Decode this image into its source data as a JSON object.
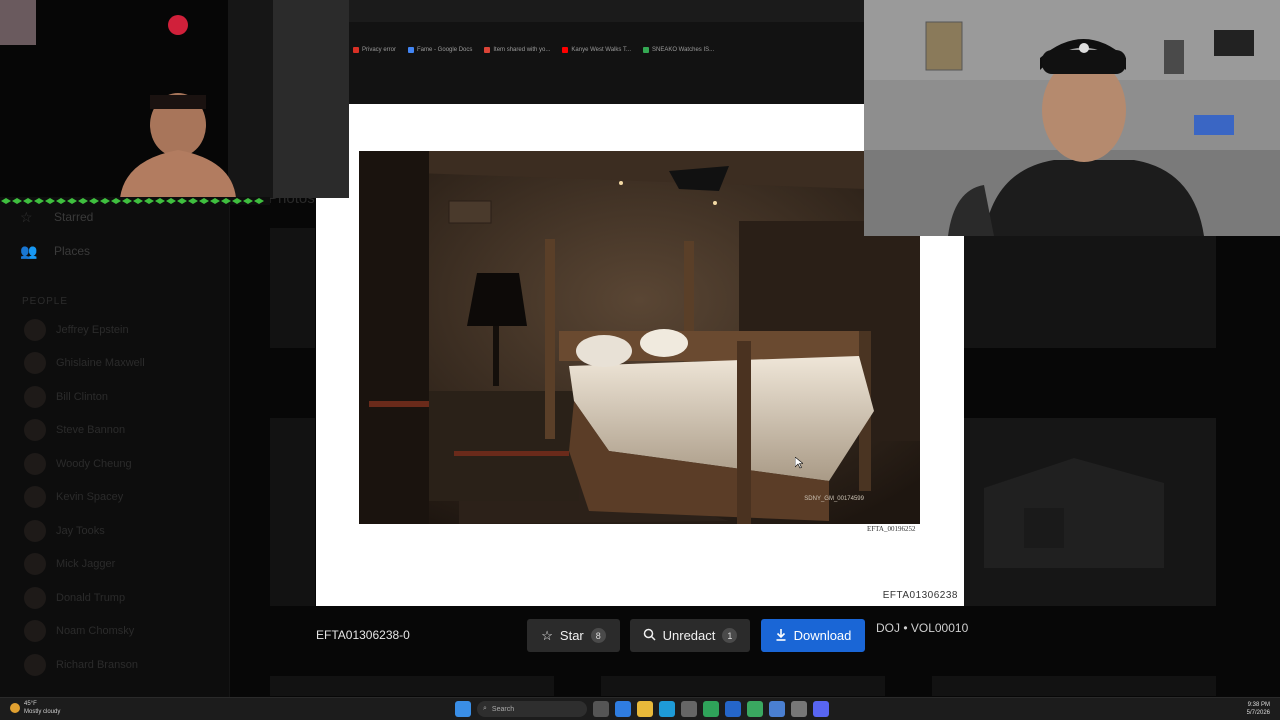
{
  "browser": {
    "bookmarks": [
      {
        "label": "Privacy error",
        "color": "#d93025"
      },
      {
        "label": "Fame - Google Docs",
        "color": "#4285f4"
      },
      {
        "label": "Item shared with yo...",
        "color": "#db4437"
      },
      {
        "label": "Kanye West Walks T...",
        "color": "#ff0000"
      },
      {
        "label": "SNEAKO Watches IS...",
        "color": "#34a853"
      }
    ]
  },
  "sidebar": {
    "items": [
      {
        "label": "Starred",
        "icon": "star-icon"
      },
      {
        "label": "Places",
        "icon": "people-icon"
      }
    ],
    "people_heading": "PEOPLE",
    "people": [
      "Jeffrey Epstein",
      "Ghislaine Maxwell",
      "Bill Clinton",
      "Steve Bannon",
      "Woody Cheung",
      "Kevin Spacey",
      "Jay Tooks",
      "Mick Jagger",
      "Donald Trump",
      "Noam Chomsky",
      "Richard Branson"
    ]
  },
  "background": {
    "heading": "Photos"
  },
  "viewer": {
    "photo_stamp": "SDNY_GM_00174599",
    "page_id": "EFTA_00196252",
    "card_id": "EFTA01306238",
    "title": "EFTA01306238-0",
    "star_label": "Star",
    "star_count": "8",
    "unredact_label": "Unredact",
    "unredact_count": "1",
    "download_label": "Download",
    "source": "DOJ • VOL00010"
  },
  "taskbar": {
    "temperature": "45°F",
    "weather": "Mostly cloudy",
    "search_placeholder": "Search",
    "time": "9:38 PM",
    "date": "5/7/2026"
  },
  "colors": {
    "download_button": "#1a66d6",
    "secondary_button": "#2b2b2b",
    "card": "#ffffff"
  }
}
